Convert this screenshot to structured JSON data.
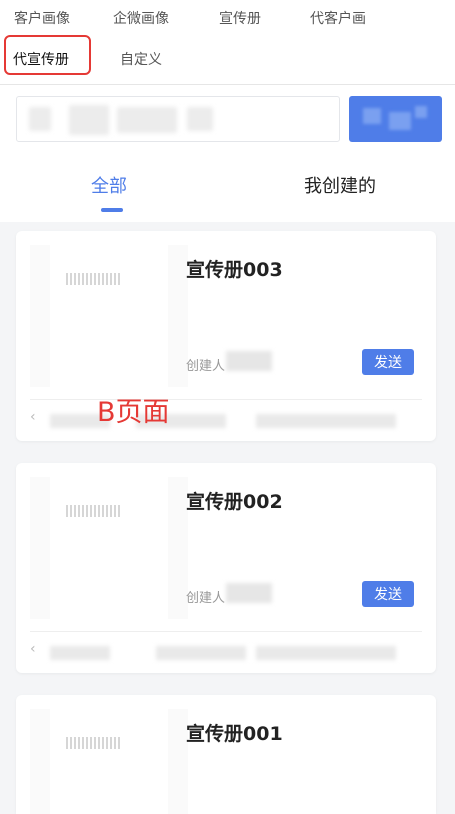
{
  "top_tabs": [
    "客户画像",
    "企微画像",
    "宣传册",
    "代客户画"
  ],
  "sub_tabs": {
    "active": "代宣传册",
    "other": "自定义"
  },
  "search": {
    "placeholder": "",
    "button_label": ""
  },
  "filter_tabs": {
    "all": "全部",
    "mine": "我创建的"
  },
  "cards": [
    {
      "title": "宣传册003",
      "creator_label": "创建人",
      "send_label": "发送"
    },
    {
      "title": "宣传册002",
      "creator_label": "创建人",
      "send_label": "发送"
    },
    {
      "title": "宣传册001"
    }
  ],
  "annotation": "B页面",
  "colors": {
    "accent": "#4f7de8",
    "annotation": "#e53935",
    "background": "#f4f5f7"
  }
}
